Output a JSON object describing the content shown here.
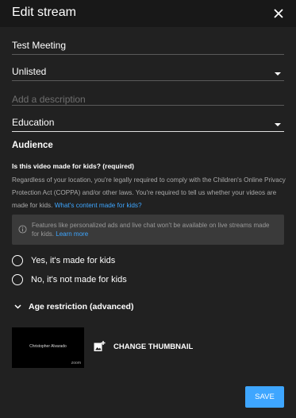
{
  "header": {
    "title": "Edit stream"
  },
  "form": {
    "title_value": "Test Meeting",
    "visibility_value": "Unlisted",
    "description_placeholder": "Add a description",
    "category_value": "Education"
  },
  "audience": {
    "heading": "Audience",
    "question": "Is this video made for kids? (required)",
    "paragraph": "Regardless of your location, you're legally required to comply with the Children's Online Privacy Protection Act (COPPA) and/or other laws. You're required to tell us whether your videos are made for kids.",
    "paragraph_link": "What's content made for kids?",
    "info_text": "Features like personalized ads and live chat won't be available on live streams made for kids.",
    "info_link": "Learn more",
    "option_yes": "Yes, it's made for kids",
    "option_no": "No, it's not made for kids"
  },
  "age_restriction": {
    "label": "Age restriction (advanced)"
  },
  "thumbnail": {
    "preview_title": "Christopher Alvarado",
    "preview_badge": "zoom",
    "change_label": "CHANGE THUMBNAIL"
  },
  "footer": {
    "save_label": "SAVE"
  },
  "colors": {
    "background": "#212121",
    "header": "#181818",
    "accent": "#3ea6ff",
    "info_box": "#3a3a3a"
  }
}
